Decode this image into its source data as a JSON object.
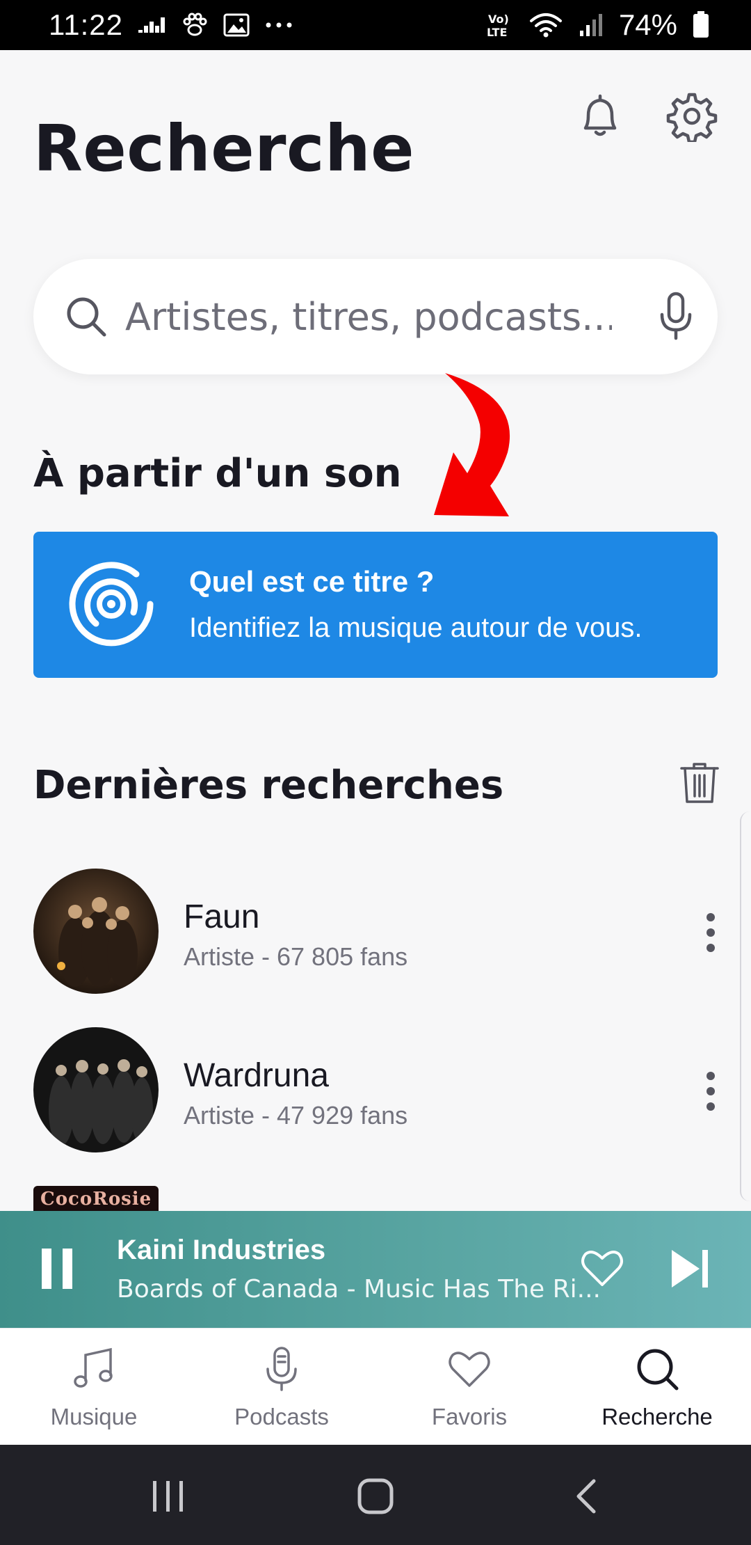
{
  "status_bar": {
    "time": "11:22",
    "battery": "74%",
    "network": "LTE"
  },
  "header": {
    "title": "Recherche",
    "icons": [
      "bell-icon",
      "gear-icon"
    ]
  },
  "search": {
    "placeholder": "Artistes, titres, podcasts..."
  },
  "sound_section": {
    "title": "À partir d'un son",
    "card_heading": "Quel est ce titre ?",
    "card_subtitle": "Identifiez la musique autour de vous.",
    "card_color": "#1e88e5"
  },
  "recent": {
    "title": "Dernières recherches",
    "items": [
      {
        "name": "Faun",
        "subtitle": "Artiste - 67 805 fans"
      },
      {
        "name": "Wardruna",
        "subtitle": "Artiste - 47 929 fans"
      },
      {
        "name": "",
        "subtitle": "",
        "thumb_text": "CocoRosie"
      }
    ]
  },
  "player": {
    "title": "Kaini Industries",
    "subtitle": "Boards of Canada - Music Has The Ri...",
    "state": "playing"
  },
  "bottom_nav": {
    "items": [
      {
        "label": "Musique",
        "icon": "music-note-icon",
        "active": false
      },
      {
        "label": "Podcasts",
        "icon": "microphone-icon",
        "active": false
      },
      {
        "label": "Favoris",
        "icon": "heart-icon",
        "active": false
      },
      {
        "label": "Recherche",
        "icon": "search-icon",
        "active": true
      }
    ]
  },
  "colors": {
    "accent_blue": "#1e88e5",
    "player_teal": "#4e9c98",
    "annotation_red": "#ff0000"
  }
}
